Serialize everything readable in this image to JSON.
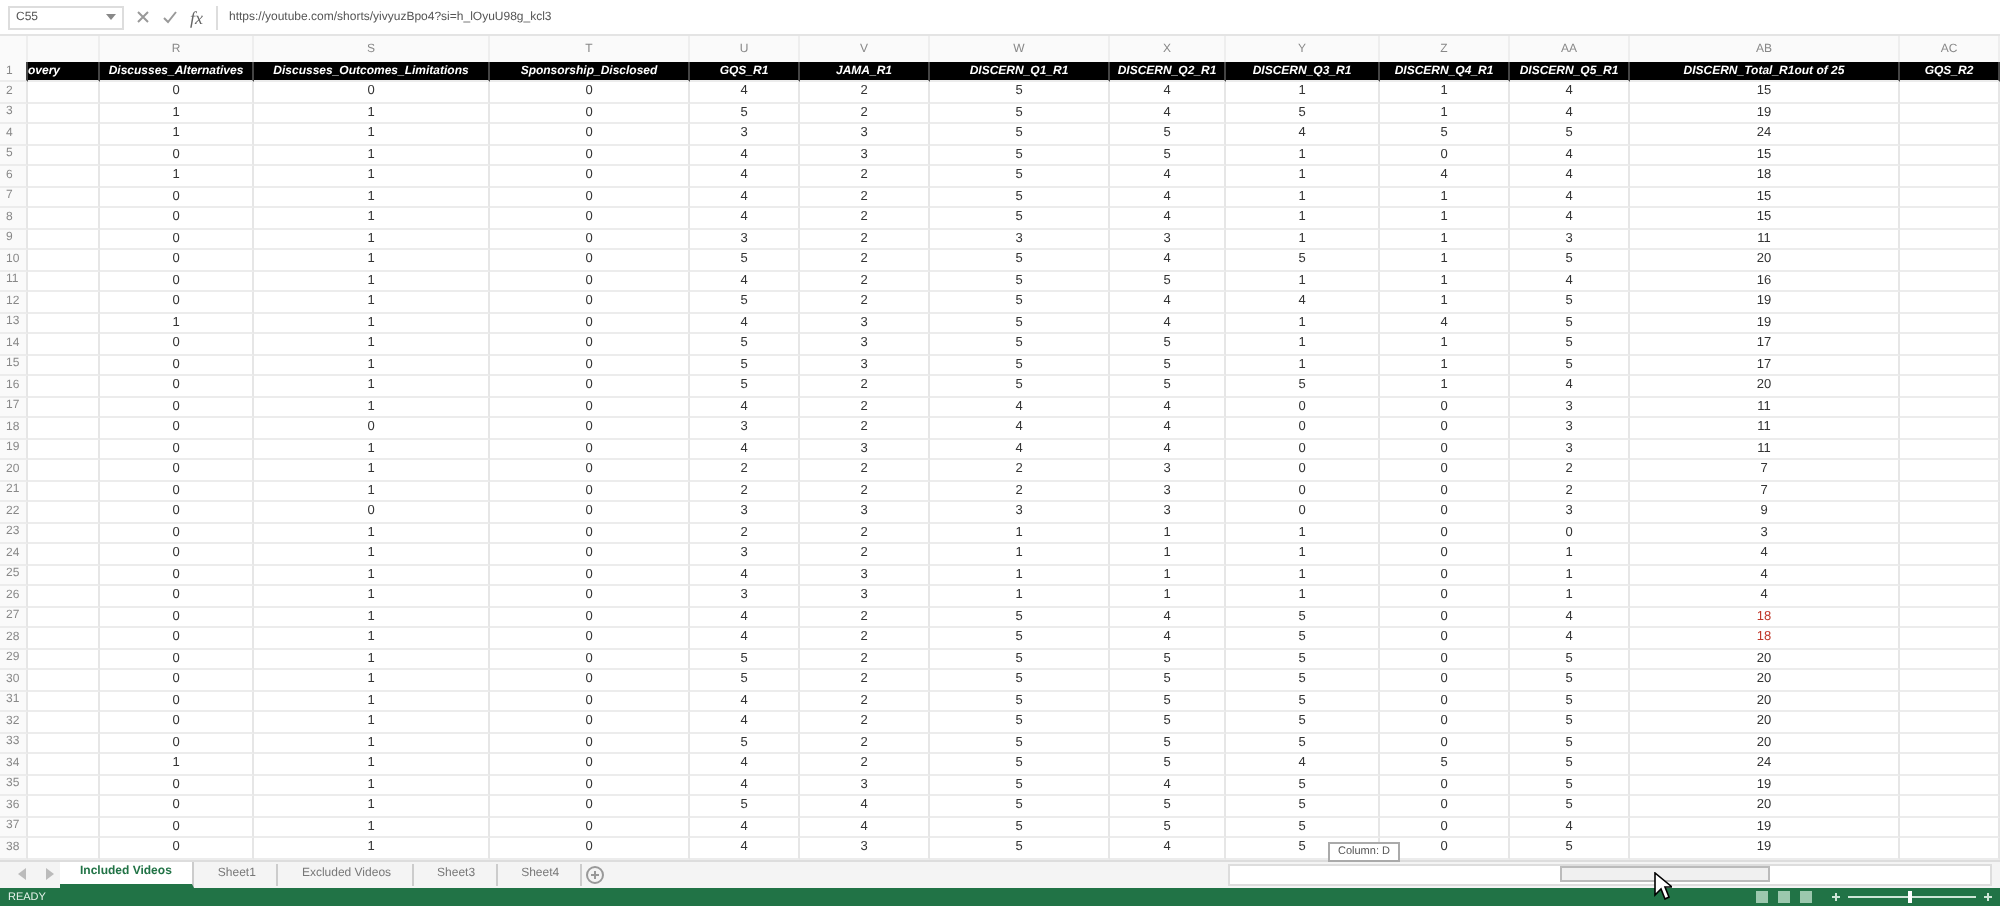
{
  "formula_bar": {
    "name_box": "C55",
    "function_label": "fx",
    "formula": "https://youtube.com/shorts/yivyuzBpo4?si=h_lOyuU98g_kcl3"
  },
  "column_letters": [
    "R",
    "S",
    "T",
    "U",
    "V",
    "W",
    "X",
    "Y",
    "Z",
    "AA",
    "AB",
    "AC"
  ],
  "table": {
    "columns": [
      "overy",
      "Discusses_Alternatives",
      "Discusses_Outcomes_Limitations",
      "Sponsorship_Disclosed",
      "GQS_R1",
      "JAMA_R1",
      "DISCERN_Q1_R1",
      "DISCERN_Q2_R1",
      "DISCERN_Q3_R1",
      "DISCERN_Q4_R1",
      "DISCERN_Q5_R1",
      "DISCERN_Total_R1out of 25",
      "GQS_R2"
    ],
    "rows": [
      {
        "number": "1",
        "kind": "header"
      },
      {
        "number": "2",
        "kind": "data",
        "cells": [
          "0",
          "0",
          "0",
          "4",
          "2",
          "5",
          "4",
          "1",
          "1",
          "4",
          "15"
        ],
        "total_flagged": false
      },
      {
        "number": "3",
        "kind": "data",
        "cells": [
          "1",
          "1",
          "0",
          "5",
          "2",
          "5",
          "4",
          "5",
          "1",
          "4",
          "19"
        ],
        "total_flagged": false
      },
      {
        "number": "4",
        "kind": "data",
        "cells": [
          "1",
          "1",
          "0",
          "3",
          "3",
          "5",
          "5",
          "4",
          "5",
          "5",
          "24"
        ],
        "total_flagged": false
      },
      {
        "number": "5",
        "kind": "data",
        "cells": [
          "0",
          "1",
          "0",
          "4",
          "3",
          "5",
          "5",
          "1",
          "0",
          "4",
          "15"
        ],
        "total_flagged": false
      },
      {
        "number": "6",
        "kind": "data",
        "cells": [
          "1",
          "1",
          "0",
          "4",
          "2",
          "5",
          "4",
          "1",
          "4",
          "4",
          "18"
        ],
        "total_flagged": false
      },
      {
        "number": "7",
        "kind": "data",
        "cells": [
          "0",
          "1",
          "0",
          "4",
          "2",
          "5",
          "4",
          "1",
          "1",
          "4",
          "15"
        ],
        "total_flagged": false
      },
      {
        "number": "8",
        "kind": "data",
        "cells": [
          "0",
          "1",
          "0",
          "4",
          "2",
          "5",
          "4",
          "1",
          "1",
          "4",
          "15"
        ],
        "total_flagged": false
      },
      {
        "number": "9",
        "kind": "data",
        "cells": [
          "0",
          "1",
          "0",
          "3",
          "2",
          "3",
          "3",
          "1",
          "1",
          "3",
          "11"
        ],
        "total_flagged": false
      },
      {
        "number": "10",
        "kind": "data",
        "cells": [
          "0",
          "1",
          "0",
          "5",
          "2",
          "5",
          "4",
          "5",
          "1",
          "5",
          "20"
        ],
        "total_flagged": false
      },
      {
        "number": "11",
        "kind": "data",
        "cells": [
          "0",
          "1",
          "0",
          "4",
          "2",
          "5",
          "5",
          "1",
          "1",
          "4",
          "16"
        ],
        "total_flagged": false
      },
      {
        "number": "12",
        "kind": "data",
        "cells": [
          "0",
          "1",
          "0",
          "5",
          "2",
          "5",
          "4",
          "4",
          "1",
          "5",
          "19"
        ],
        "total_flagged": false
      },
      {
        "number": "13",
        "kind": "data",
        "cells": [
          "1",
          "1",
          "0",
          "4",
          "3",
          "5",
          "4",
          "1",
          "4",
          "5",
          "19"
        ],
        "total_flagged": false
      },
      {
        "number": "14",
        "kind": "data",
        "cells": [
          "0",
          "1",
          "0",
          "5",
          "3",
          "5",
          "5",
          "1",
          "1",
          "5",
          "17"
        ],
        "total_flagged": false
      },
      {
        "number": "15",
        "kind": "data",
        "cells": [
          "0",
          "1",
          "0",
          "5",
          "3",
          "5",
          "5",
          "1",
          "1",
          "5",
          "17"
        ],
        "total_flagged": false
      },
      {
        "number": "16",
        "kind": "data",
        "cells": [
          "0",
          "1",
          "0",
          "5",
          "2",
          "5",
          "5",
          "5",
          "1",
          "4",
          "20"
        ],
        "total_flagged": false
      },
      {
        "number": "17",
        "kind": "data",
        "cells": [
          "0",
          "1",
          "0",
          "4",
          "2",
          "4",
          "4",
          "0",
          "0",
          "3",
          "11"
        ],
        "total_flagged": false
      },
      {
        "number": "18",
        "kind": "data",
        "cells": [
          "0",
          "0",
          "0",
          "3",
          "2",
          "4",
          "4",
          "0",
          "0",
          "3",
          "11"
        ],
        "total_flagged": false
      },
      {
        "number": "19",
        "kind": "data",
        "cells": [
          "0",
          "1",
          "0",
          "4",
          "3",
          "4",
          "4",
          "0",
          "0",
          "3",
          "11"
        ],
        "total_flagged": false
      },
      {
        "number": "20",
        "kind": "data",
        "cells": [
          "0",
          "1",
          "0",
          "2",
          "2",
          "2",
          "3",
          "0",
          "0",
          "2",
          "7"
        ],
        "total_flagged": false
      },
      {
        "number": "21",
        "kind": "data",
        "cells": [
          "0",
          "1",
          "0",
          "2",
          "2",
          "2",
          "3",
          "0",
          "0",
          "2",
          "7"
        ],
        "total_flagged": false
      },
      {
        "number": "22",
        "kind": "data",
        "cells": [
          "0",
          "0",
          "0",
          "3",
          "3",
          "3",
          "3",
          "0",
          "0",
          "3",
          "9"
        ],
        "total_flagged": false
      },
      {
        "number": "23",
        "kind": "data",
        "cells": [
          "0",
          "1",
          "0",
          "2",
          "2",
          "1",
          "1",
          "1",
          "0",
          "0",
          "3"
        ],
        "total_flagged": false
      },
      {
        "number": "24",
        "kind": "data",
        "cells": [
          "0",
          "1",
          "0",
          "3",
          "2",
          "1",
          "1",
          "1",
          "0",
          "1",
          "4"
        ],
        "total_flagged": false
      },
      {
        "number": "25",
        "kind": "data",
        "cells": [
          "0",
          "1",
          "0",
          "4",
          "3",
          "1",
          "1",
          "1",
          "0",
          "1",
          "4"
        ],
        "total_flagged": false
      },
      {
        "number": "26",
        "kind": "data",
        "cells": [
          "0",
          "1",
          "0",
          "3",
          "3",
          "1",
          "1",
          "1",
          "0",
          "1",
          "4"
        ],
        "total_flagged": false
      },
      {
        "number": "27",
        "kind": "data",
        "cells": [
          "0",
          "1",
          "0",
          "4",
          "2",
          "5",
          "4",
          "5",
          "0",
          "4",
          "18"
        ],
        "total_flagged": true
      },
      {
        "number": "28",
        "kind": "data",
        "cells": [
          "0",
          "1",
          "0",
          "4",
          "2",
          "5",
          "4",
          "5",
          "0",
          "4",
          "18"
        ],
        "total_flagged": true
      },
      {
        "number": "29",
        "kind": "data",
        "cells": [
          "0",
          "1",
          "0",
          "5",
          "2",
          "5",
          "5",
          "5",
          "0",
          "5",
          "20"
        ],
        "total_flagged": false
      },
      {
        "number": "30",
        "kind": "data",
        "cells": [
          "0",
          "1",
          "0",
          "5",
          "2",
          "5",
          "5",
          "5",
          "0",
          "5",
          "20"
        ],
        "total_flagged": false
      },
      {
        "number": "31",
        "kind": "data",
        "cells": [
          "0",
          "1",
          "0",
          "4",
          "2",
          "5",
          "5",
          "5",
          "0",
          "5",
          "20"
        ],
        "total_flagged": false
      },
      {
        "number": "32",
        "kind": "data",
        "cells": [
          "0",
          "1",
          "0",
          "4",
          "2",
          "5",
          "5",
          "5",
          "0",
          "5",
          "20"
        ],
        "total_flagged": false
      },
      {
        "number": "33",
        "kind": "data",
        "cells": [
          "0",
          "1",
          "0",
          "5",
          "2",
          "5",
          "5",
          "5",
          "0",
          "5",
          "20"
        ],
        "total_flagged": false
      },
      {
        "number": "34",
        "kind": "data",
        "cells": [
          "1",
          "1",
          "0",
          "4",
          "2",
          "5",
          "5",
          "4",
          "5",
          "5",
          "24"
        ],
        "total_flagged": false
      },
      {
        "number": "35",
        "kind": "data",
        "cells": [
          "0",
          "1",
          "0",
          "4",
          "3",
          "5",
          "4",
          "5",
          "0",
          "5",
          "19"
        ],
        "total_flagged": false
      },
      {
        "number": "36",
        "kind": "data",
        "cells": [
          "0",
          "1",
          "0",
          "5",
          "4",
          "5",
          "5",
          "5",
          "0",
          "5",
          "20"
        ],
        "total_flagged": false
      },
      {
        "number": "37",
        "kind": "data",
        "cells": [
          "0",
          "1",
          "0",
          "4",
          "4",
          "5",
          "5",
          "5",
          "0",
          "4",
          "19"
        ],
        "total_flagged": false
      },
      {
        "number": "38",
        "kind": "data",
        "cells": [
          "0",
          "1",
          "0",
          "4",
          "3",
          "5",
          "4",
          "5",
          "0",
          "5",
          "19"
        ],
        "total_flagged": false
      }
    ]
  },
  "sheet_tabs": [
    {
      "label": "Included Videos",
      "selected": true
    },
    {
      "label": "Sheet1",
      "selected": false
    },
    {
      "label": "Excluded Videos",
      "selected": false
    },
    {
      "label": "Sheet3",
      "selected": false
    },
    {
      "label": "Sheet4",
      "selected": false
    }
  ],
  "scroll_tooltip": "Column: D",
  "status_bar": {
    "status": "READY"
  }
}
